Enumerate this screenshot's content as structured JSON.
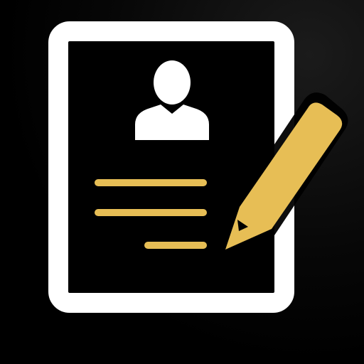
{
  "icon": {
    "name": "resume-edit-icon",
    "parts": [
      "document-frame",
      "profile-silhouette",
      "text-lines",
      "pencil"
    ]
  },
  "colors": {
    "background": "#000000",
    "frame": "#FFFFFF",
    "accent": "#E7BE55"
  }
}
